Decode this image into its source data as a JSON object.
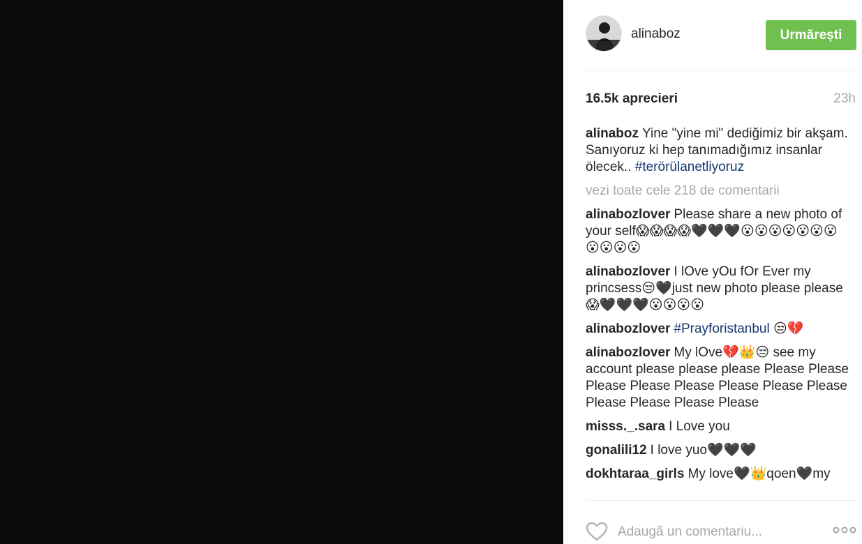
{
  "header": {
    "username": "alinaboz",
    "follow_label": "Urmărești"
  },
  "stats": {
    "likes": "16.5k aprecieri",
    "time": "23h"
  },
  "caption": {
    "user": "alinaboz",
    "text": "Yine \"yine mi\" dediğimiz bir akşam. Sanıyoruz ki hep tanımadığımız insanlar ölecek..",
    "hashtag": "#terörülanetliyoruz"
  },
  "view_all": "vezi toate cele 218 de comentarii",
  "comments": [
    {
      "user": "alinabozlover",
      "text": "Please share a new photo of your self😱😱😱😱🖤🖤🖤😮😮😮😮😮😮😮😮😮😮😮",
      "tag": ""
    },
    {
      "user": "alinabozlover",
      "text": "I lOve yOu fOr Ever my princsess😒🖤just new photo please please😱🖤🖤🖤😮😮😮😮",
      "tag": ""
    },
    {
      "user": "alinabozlover",
      "text": "",
      "tag": "#Prayforistanbul",
      "suffix": " 😒💔"
    },
    {
      "user": "alinabozlover",
      "text": "My lOve💔👑😒 see my account please please please Please Please Please Please Please Please Please Please Please Please Please Please",
      "tag": ""
    },
    {
      "user": "misss._.sara",
      "text": "I Love you",
      "tag": ""
    },
    {
      "user": "gonalili12",
      "text": "I love yuo🖤🖤🖤",
      "tag": ""
    },
    {
      "user": "dokhtaraa_girls",
      "text": "My love🖤👑qoen🖤my",
      "tag": ""
    }
  ],
  "footer": {
    "comment_placeholder": "Adaugă un comentariu...",
    "like_icon": "heart-outline-icon",
    "more_icon": "more-options-icon"
  },
  "colors": {
    "follow_bg": "#70c050",
    "hashtag": "#12376f",
    "muted": "#a5a7aa",
    "photo_bg": "#0a0a0a"
  }
}
